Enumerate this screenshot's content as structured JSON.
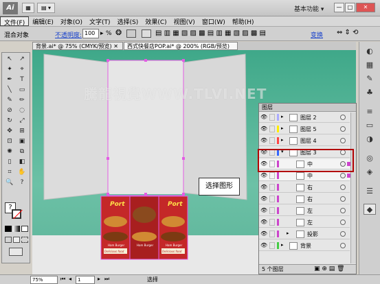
{
  "window": {
    "app_logo": "Ai",
    "title_btn_a": "▦",
    "title_btn_b": "▤ ▾",
    "workspace": "基本功能",
    "workspace_arrow": "▾",
    "min": "—",
    "max": "□",
    "close": "✕"
  },
  "menu": [
    "文件(F)",
    "编辑(E)",
    "对象(O)",
    "文字(T)",
    "选择(S)",
    "效果(C)",
    "视图(V)",
    "窗口(W)",
    "帮助(H)"
  ],
  "control": {
    "object_label": "混合对象",
    "opacity_label": "不透明度:",
    "opacity_value": "100",
    "opacity_arrow": "▸",
    "percent": "%",
    "isolate": "隔离组",
    "edit_contents": "编辑内容",
    "transform": "变换"
  },
  "tabs": [
    {
      "label": "背景.ai* @ 75% (CMYK/预览)",
      "close": "✕"
    },
    {
      "label": "西式快餐店POP.ai* @ 200% (RGB/预览)",
      "close": "✕"
    }
  ],
  "watermark": "騰龍視覺WWW.TLVI.NET",
  "callout": "选择图形",
  "layers": {
    "title": "图层",
    "rows": [
      {
        "name": "图层 2",
        "eye": "👁",
        "color": "#aaaaff",
        "arrow": "▸"
      },
      {
        "name": "图层 5",
        "eye": "👁",
        "color": "#ffee00",
        "arrow": "▸"
      },
      {
        "name": "图层 4",
        "eye": "👁",
        "color": "#ff4444",
        "arrow": "▸"
      },
      {
        "name": "图层 3",
        "eye": "👁",
        "color": "#3366ff",
        "arrow": "▾"
      },
      {
        "name": "中",
        "eye": "👁",
        "color": "#cc44cc",
        "arrow": ""
      },
      {
        "name": "中",
        "eye": "👁",
        "color": "#cc44cc",
        "arrow": ""
      },
      {
        "name": "右",
        "eye": "👁",
        "color": "#cc44cc",
        "arrow": ""
      },
      {
        "name": "右",
        "eye": "👁",
        "color": "#cc44cc",
        "arrow": ""
      },
      {
        "name": "左",
        "eye": "👁",
        "color": "#cc44cc",
        "arrow": ""
      },
      {
        "name": "左",
        "eye": "👁",
        "color": "#cc44cc",
        "arrow": ""
      },
      {
        "name": "投影",
        "eye": "👁",
        "color": "#cc44cc",
        "arrow": "▸"
      },
      {
        "name": "背景",
        "eye": "👁",
        "color": "#44cc44",
        "arrow": "▸"
      }
    ],
    "footer": "5 个图层"
  },
  "status": {
    "zoom": "75%",
    "page": "1",
    "tool": "选择",
    "nav_first": "⏮",
    "nav_prev": "◂",
    "nav_next": "▸",
    "nav_last": "⏭"
  },
  "poster": {
    "brand": "Port",
    "bottom_text": "Ham Burger",
    "tagline": "Delicious food"
  },
  "tools": [
    "↖",
    "↗",
    "✦",
    "⌖",
    "✒",
    "T",
    "╲",
    "▭",
    "✎",
    "✏",
    "⊘",
    "◌",
    "↻",
    "⤢",
    "✥",
    "⊞",
    "⊡",
    "▣",
    "✺",
    "⧉",
    "▯",
    "◧",
    "⌗",
    "✋",
    "🔍",
    "?"
  ]
}
